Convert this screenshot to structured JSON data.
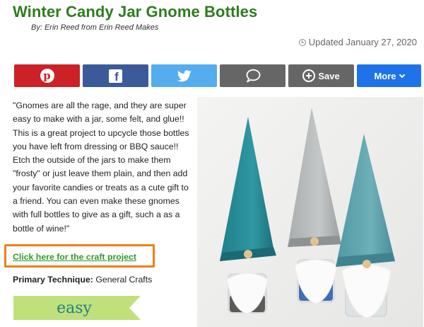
{
  "article": {
    "title": "Winter Candy Jar Gnome Bottles",
    "byline": "By: Erin Reed from Erin Reed Makes",
    "updated": "Updated January 27, 2020"
  },
  "share_bar": {
    "pinterest_icon": "pinterest-icon",
    "facebook_icon": "facebook-icon",
    "twitter_icon": "twitter-icon",
    "comment_icon": "comment-icon",
    "save_label": "Save",
    "more_label": "More",
    "colors": {
      "pinterest": "#cc2127",
      "facebook": "#3b5a9a",
      "twitter": "#55acee",
      "neutral": "#666666",
      "more": "#1e73e8"
    }
  },
  "content": {
    "description": "\"Gnomes are all the rage, and they are super easy to make with a jar, some felt, and glue!! This is a great project to upcycle those bottles you have left from dressing or BBQ sauce!! Etch the outside of the jars to make them \"frosty\" or just leave them plain, and then add your favorite candies or treats as a cute gift to a friend. You can even make these gnomes with full bottles to give as a gift, such a as a bottle of wine!\"",
    "craft_link": "Click here for the craft project",
    "technique_label": "Primary Technique:",
    "technique_value": "General Crafts",
    "difficulty": "easy"
  },
  "colors": {
    "title_green": "#2e7d1e",
    "link_green": "#2e9a2e",
    "highlight_orange": "#f07d1b",
    "badge_green": "#bfe07a",
    "badge_text": "#1e7f8e"
  }
}
